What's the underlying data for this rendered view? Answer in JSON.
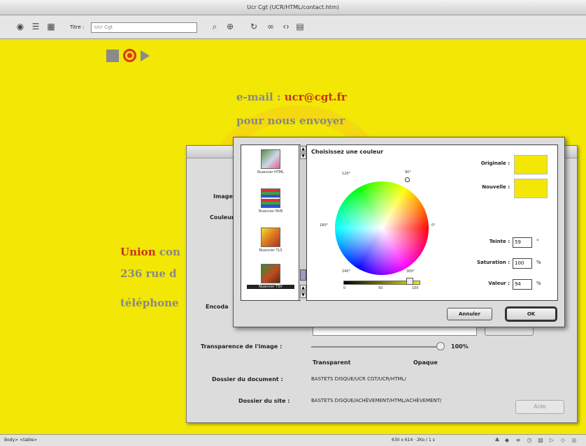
{
  "window": {
    "title": "Ucr Cgt (UCR/HTML/contact.htm)"
  },
  "toolbar": {
    "title_label": "Titre :",
    "title_value": "Ucr Cgt"
  },
  "page": {
    "email_prefix": "e-mail : ",
    "email": "ucr@cgt.fr",
    "send_line": "pour nous envoyer",
    "union_brand": "Union",
    "union_rest": " con",
    "street": "236 rue d",
    "phone": "téléphone"
  },
  "props_dialog": {
    "image_label": "Image",
    "color_label": "Couleur",
    "encoding_label": "Encoda",
    "transparency_label": "Transparence de l'image :",
    "transparency_pct": "100%",
    "transparency_value": 1.0,
    "transparent_label": "Transparent",
    "opaque_label": "Opaque",
    "document_folder_label": "Dossier du document :",
    "document_folder_value": "BASTETS DISQUE/UCR CGT/UCR/HTML/",
    "site_folder_label": "Dossier du site :",
    "site_folder_value": "BASTETS DISQUE/ACHÈVEMENT/HTML/ACHÈVEMENT/",
    "site_button": "Aide"
  },
  "color_picker": {
    "panel_title": "Choisissez une couleur",
    "pickers": [
      {
        "label": "Nuancier HTML",
        "selected": false
      },
      {
        "label": "Nuancier RVB",
        "selected": false
      },
      {
        "label": "Nuancier TLS",
        "selected": false
      },
      {
        "label": "Nuancier TSV",
        "selected": true
      }
    ],
    "degrees": {
      "d90": "90°",
      "d120": "120°",
      "d0": "0°",
      "d180": "180°",
      "d240": "240°",
      "d300": "300°"
    },
    "original_label": "Originale :",
    "new_label": "Nouvelle :",
    "original_color": "#f2e705",
    "new_color": "#f2e705",
    "hue_label": "Teinte :",
    "hue_value": "59",
    "hue_unit": "°",
    "saturation_label": "Saturation :",
    "saturation_value": "100",
    "saturation_unit": "%",
    "value_label": "Valeur :",
    "value_value": "94",
    "value_unit": "%",
    "value_ticks": {
      "t0": "0",
      "t50": "50",
      "t100": "100"
    },
    "cancel_button": "Annuler",
    "ok_button": "OK"
  },
  "status": {
    "left": "Body> <table> ",
    "right": "630 x 614 · 2Ko / 1 s"
  },
  "colors": {
    "page_bg": "#f2e705",
    "accent_red": "#c8321a"
  }
}
